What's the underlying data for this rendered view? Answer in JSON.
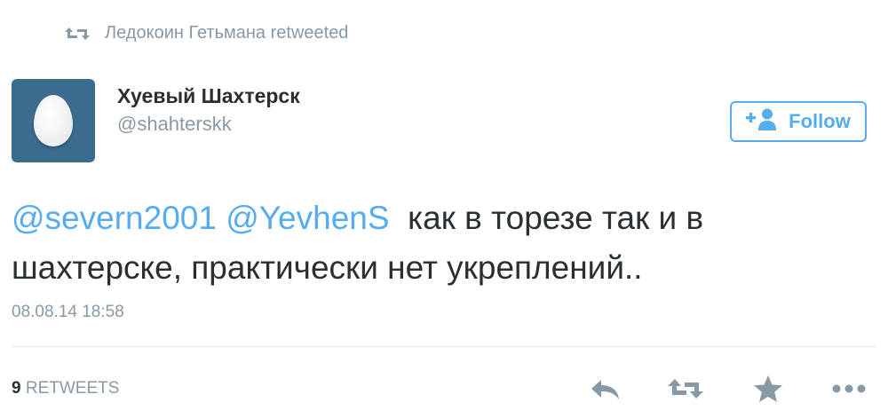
{
  "retweet_context": {
    "icon": "retweet-icon",
    "text": "Ледокоин Гетьмана retweeted"
  },
  "user": {
    "avatar_icon": "egg-avatar",
    "name": "Хуевый Шахтерск",
    "handle": "@shahterskk"
  },
  "follow_button": {
    "icon": "add-user-icon",
    "label": "Follow"
  },
  "tweet": {
    "mentions": [
      "@severn2001",
      "@YevhenS"
    ],
    "text_line1": "как в торезе так и в",
    "text_line2": "шахтерске, практически нет укреплений..",
    "timestamp": "08.08.14 18:58"
  },
  "stats": {
    "retweets_count": "9",
    "retweets_label": "RETWEETS"
  },
  "actions": [
    "reply-icon",
    "retweet-icon",
    "favorite-icon",
    "more-icon"
  ],
  "colors": {
    "accent": "#55acee",
    "muted": "#8899a6",
    "text": "#292f33",
    "avatar_bg": "#3b6c8f"
  }
}
